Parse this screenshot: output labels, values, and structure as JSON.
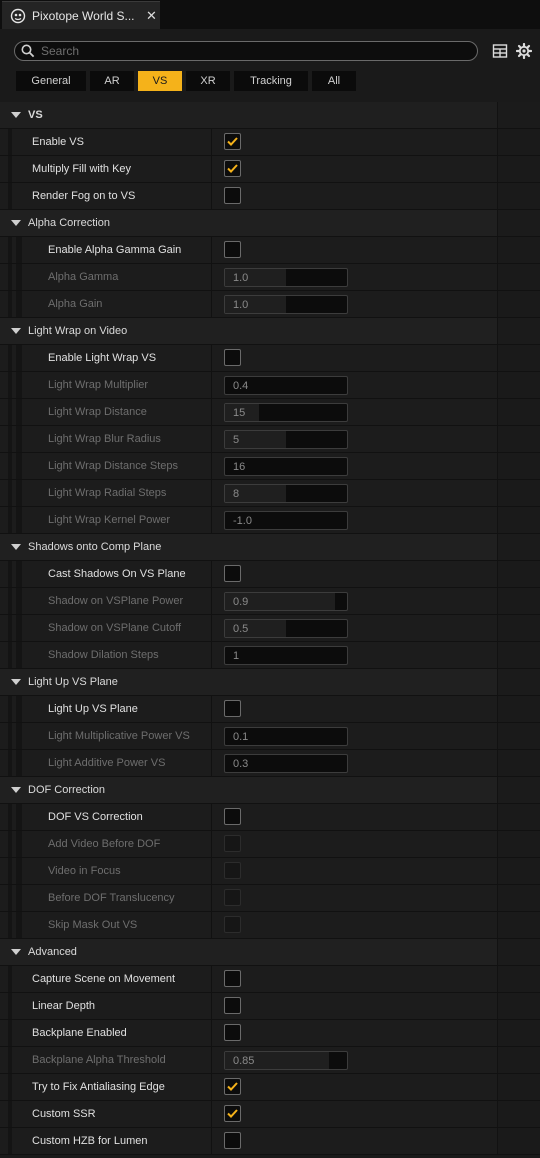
{
  "tab": {
    "title": "Pixotope World S...",
    "close_label": "✕"
  },
  "search": {
    "placeholder": "Search"
  },
  "filters": [
    {
      "label": "General",
      "active": false
    },
    {
      "label": "AR",
      "active": false
    },
    {
      "label": "VS",
      "active": true
    },
    {
      "label": "XR",
      "active": false
    },
    {
      "label": "Tracking",
      "active": false
    },
    {
      "label": "All",
      "active": false
    }
  ],
  "colors": {
    "accent": "#f5b21a"
  },
  "rows": [
    {
      "type": "header",
      "level": 0,
      "label": "VS"
    },
    {
      "type": "checkbox",
      "level": 1,
      "label": "Enable VS",
      "checked": true,
      "enabled": true
    },
    {
      "type": "checkbox",
      "level": 1,
      "label": "Multiply Fill with Key",
      "checked": true,
      "enabled": true
    },
    {
      "type": "checkbox",
      "level": 1,
      "label": "Render Fog on to VS",
      "checked": false,
      "enabled": true
    },
    {
      "type": "header",
      "level": 1,
      "label": "Alpha Correction"
    },
    {
      "type": "checkbox",
      "level": 2,
      "label": "Enable Alpha Gamma Gain",
      "checked": false,
      "enabled": true
    },
    {
      "type": "number",
      "level": 2,
      "label": "Alpha Gamma",
      "value": "1.0",
      "fill": 0.5,
      "enabled": false
    },
    {
      "type": "number",
      "level": 2,
      "label": "Alpha Gain",
      "value": "1.0",
      "fill": 0.5,
      "enabled": false
    },
    {
      "type": "header",
      "level": 1,
      "label": "Light Wrap on Video"
    },
    {
      "type": "checkbox",
      "level": 2,
      "label": "Enable Light Wrap VS",
      "checked": false,
      "enabled": true
    },
    {
      "type": "number",
      "level": 2,
      "label": "Light Wrap Multiplier",
      "value": "0.4",
      "fill": 0.0,
      "enabled": false
    },
    {
      "type": "number",
      "level": 2,
      "label": "Light Wrap Distance",
      "value": "15",
      "fill": 0.28,
      "enabled": false
    },
    {
      "type": "number",
      "level": 2,
      "label": "Light Wrap Blur Radius",
      "value": "5",
      "fill": 0.5,
      "enabled": false
    },
    {
      "type": "number",
      "level": 2,
      "label": "Light Wrap Distance Steps",
      "value": "16",
      "fill": 0.0,
      "enabled": false
    },
    {
      "type": "number",
      "level": 2,
      "label": "Light Wrap Radial Steps",
      "value": "8",
      "fill": 0.5,
      "enabled": false
    },
    {
      "type": "number",
      "level": 2,
      "label": "Light Wrap Kernel Power",
      "value": "-1.0",
      "fill": 0.0,
      "enabled": false
    },
    {
      "type": "header",
      "level": 1,
      "label": "Shadows onto Comp Plane"
    },
    {
      "type": "checkbox",
      "level": 2,
      "label": "Cast Shadows On VS Plane",
      "checked": false,
      "enabled": true
    },
    {
      "type": "number",
      "level": 2,
      "label": "Shadow on VSPlane Power",
      "value": "0.9",
      "fill": 0.9,
      "enabled": false
    },
    {
      "type": "number",
      "level": 2,
      "label": "Shadow on VSPlane Cutoff",
      "value": "0.5",
      "fill": 0.5,
      "enabled": false
    },
    {
      "type": "number",
      "level": 2,
      "label": "Shadow Dilation Steps",
      "value": "1",
      "fill": 0.0,
      "enabled": false
    },
    {
      "type": "header",
      "level": 1,
      "label": "Light Up VS Plane"
    },
    {
      "type": "checkbox",
      "level": 2,
      "label": "Light Up VS Plane",
      "checked": false,
      "enabled": true
    },
    {
      "type": "number",
      "level": 2,
      "label": "Light Multiplicative Power VS",
      "value": "0.1",
      "fill": 0.0,
      "enabled": false
    },
    {
      "type": "number",
      "level": 2,
      "label": "Light Additive Power VS",
      "value": "0.3",
      "fill": 0.0,
      "enabled": false
    },
    {
      "type": "header",
      "level": 1,
      "label": "DOF Correction"
    },
    {
      "type": "checkbox",
      "level": 2,
      "label": "DOF VS Correction",
      "checked": false,
      "enabled": true
    },
    {
      "type": "checkbox",
      "level": 2,
      "label": "Add Video Before DOF",
      "checked": false,
      "enabled": false
    },
    {
      "type": "checkbox",
      "level": 2,
      "label": "Video in Focus",
      "checked": false,
      "enabled": false
    },
    {
      "type": "checkbox",
      "level": 2,
      "label": "Before DOF Translucency",
      "checked": false,
      "enabled": false
    },
    {
      "type": "checkbox",
      "level": 2,
      "label": "Skip Mask Out VS",
      "checked": false,
      "enabled": false
    },
    {
      "type": "header",
      "level": 1,
      "label": "Advanced"
    },
    {
      "type": "checkbox",
      "level": 1,
      "label": "Capture Scene on Movement",
      "checked": false,
      "enabled": true
    },
    {
      "type": "checkbox",
      "level": 1,
      "label": "Linear Depth",
      "checked": false,
      "enabled": true
    },
    {
      "type": "checkbox",
      "level": 1,
      "label": "Backplane Enabled",
      "checked": false,
      "enabled": true
    },
    {
      "type": "number",
      "level": 1,
      "label": "Backplane Alpha Threshold",
      "value": "0.85",
      "fill": 0.85,
      "enabled": false
    },
    {
      "type": "checkbox",
      "level": 1,
      "label": "Try to Fix Antialiasing Edge",
      "checked": true,
      "enabled": true
    },
    {
      "type": "checkbox",
      "level": 1,
      "label": "Custom SSR",
      "checked": true,
      "enabled": true
    },
    {
      "type": "checkbox",
      "level": 1,
      "label": "Custom HZB for Lumen",
      "checked": false,
      "enabled": true
    }
  ]
}
